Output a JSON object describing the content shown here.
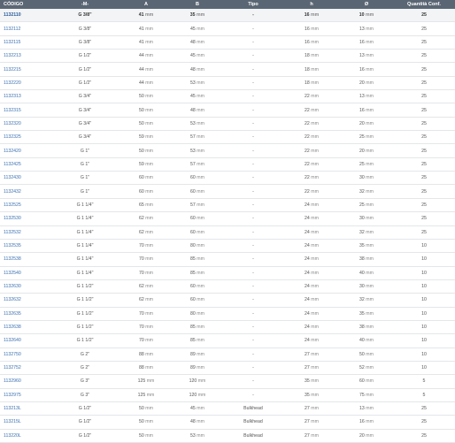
{
  "table": {
    "headers": [
      "CÓDIGO",
      "-M-",
      "A",
      "B",
      "Tipo",
      "h",
      "Ø",
      "Quantità Conf."
    ],
    "unit": "mm",
    "rows": [
      {
        "code": "1132110",
        "m": "G 3/8\"",
        "a": "41",
        "b": "35",
        "tipo": "-",
        "h": "16",
        "d": "10",
        "q": "25"
      },
      {
        "code": "1132112",
        "m": "G 3/8\"",
        "a": "41",
        "b": "45",
        "tipo": "-",
        "h": "16",
        "d": "13",
        "q": "25"
      },
      {
        "code": "1132115",
        "m": "G 3/8\"",
        "a": "41",
        "b": "48",
        "tipo": "-",
        "h": "16",
        "d": "16",
        "q": "25"
      },
      {
        "code": "1132213",
        "m": "G 1/2\"",
        "a": "44",
        "b": "45",
        "tipo": "-",
        "h": "18",
        "d": "13",
        "q": "25"
      },
      {
        "code": "1132215",
        "m": "G 1/2\"",
        "a": "44",
        "b": "48",
        "tipo": "-",
        "h": "18",
        "d": "16",
        "q": "25"
      },
      {
        "code": "1132220",
        "m": "G 1/2\"",
        "a": "44",
        "b": "53",
        "tipo": "-",
        "h": "18",
        "d": "20",
        "q": "25"
      },
      {
        "code": "1132313",
        "m": "G 3/4\"",
        "a": "50",
        "b": "45",
        "tipo": "-",
        "h": "22",
        "d": "13",
        "q": "25"
      },
      {
        "code": "1132315",
        "m": "G 3/4\"",
        "a": "50",
        "b": "48",
        "tipo": "-",
        "h": "22",
        "d": "16",
        "q": "25"
      },
      {
        "code": "1132320",
        "m": "G 3/4\"",
        "a": "50",
        "b": "53",
        "tipo": "-",
        "h": "22",
        "d": "20",
        "q": "25"
      },
      {
        "code": "1132325",
        "m": "G 3/4\"",
        "a": "59",
        "b": "57",
        "tipo": "-",
        "h": "22",
        "d": "25",
        "q": "25"
      },
      {
        "code": "1132420",
        "m": "G 1\"",
        "a": "50",
        "b": "53",
        "tipo": "-",
        "h": "22",
        "d": "20",
        "q": "25"
      },
      {
        "code": "1132425",
        "m": "G 1\"",
        "a": "59",
        "b": "57",
        "tipo": "-",
        "h": "22",
        "d": "25",
        "q": "25"
      },
      {
        "code": "1132430",
        "m": "G 1\"",
        "a": "60",
        "b": "60",
        "tipo": "-",
        "h": "22",
        "d": "30",
        "q": "25"
      },
      {
        "code": "1132432",
        "m": "G 1\"",
        "a": "60",
        "b": "60",
        "tipo": "-",
        "h": "22",
        "d": "32",
        "q": "25"
      },
      {
        "code": "1132525",
        "m": "G 1 1/4\"",
        "a": "65",
        "b": "57",
        "tipo": "-",
        "h": "24",
        "d": "25",
        "q": "25"
      },
      {
        "code": "1132530",
        "m": "G 1 1/4\"",
        "a": "62",
        "b": "60",
        "tipo": "-",
        "h": "24",
        "d": "30",
        "q": "25"
      },
      {
        "code": "1132532",
        "m": "G 1 1/4\"",
        "a": "62",
        "b": "60",
        "tipo": "-",
        "h": "24",
        "d": "32",
        "q": "25"
      },
      {
        "code": "1132535",
        "m": "G 1 1/4\"",
        "a": "70",
        "b": "80",
        "tipo": "-",
        "h": "24",
        "d": "35",
        "q": "10"
      },
      {
        "code": "1132538",
        "m": "G 1 1/4\"",
        "a": "70",
        "b": "85",
        "tipo": "-",
        "h": "24",
        "d": "38",
        "q": "10"
      },
      {
        "code": "1132540",
        "m": "G 1 1/4\"",
        "a": "70",
        "b": "85",
        "tipo": "-",
        "h": "24",
        "d": "40",
        "q": "10"
      },
      {
        "code": "1132630",
        "m": "G 1 1/2\"",
        "a": "62",
        "b": "60",
        "tipo": "-",
        "h": "24",
        "d": "30",
        "q": "10"
      },
      {
        "code": "1132632",
        "m": "G 1 1/2\"",
        "a": "62",
        "b": "60",
        "tipo": "-",
        "h": "24",
        "d": "32",
        "q": "10"
      },
      {
        "code": "1132635",
        "m": "G 1 1/2\"",
        "a": "70",
        "b": "80",
        "tipo": "-",
        "h": "24",
        "d": "35",
        "q": "10"
      },
      {
        "code": "1132638",
        "m": "G 1 1/2\"",
        "a": "70",
        "b": "85",
        "tipo": "-",
        "h": "24",
        "d": "38",
        "q": "10"
      },
      {
        "code": "1132640",
        "m": "G 1 1/2\"",
        "a": "70",
        "b": "85",
        "tipo": "-",
        "h": "24",
        "d": "40",
        "q": "10"
      },
      {
        "code": "1132750",
        "m": "G 2\"",
        "a": "88",
        "b": "89",
        "tipo": "-",
        "h": "27",
        "d": "50",
        "q": "10"
      },
      {
        "code": "1132752",
        "m": "G 2\"",
        "a": "88",
        "b": "89",
        "tipo": "-",
        "h": "27",
        "d": "52",
        "q": "10"
      },
      {
        "code": "1132960",
        "m": "G 3\"",
        "a": "125",
        "b": "120",
        "tipo": "-",
        "h": "35",
        "d": "60",
        "q": "5"
      },
      {
        "code": "1132975",
        "m": "G 3\"",
        "a": "125",
        "b": "120",
        "tipo": "-",
        "h": "35",
        "d": "75",
        "q": "5"
      },
      {
        "code": "113213L",
        "m": "G 1/2\"",
        "a": "50",
        "b": "45",
        "tipo": "Bulkhead",
        "h": "27",
        "d": "13",
        "q": "25"
      },
      {
        "code": "113215L",
        "m": "G 1/2\"",
        "a": "50",
        "b": "48",
        "tipo": "Bulkhead",
        "h": "27",
        "d": "16",
        "q": "25"
      },
      {
        "code": "113220L",
        "m": "G 1/2\"",
        "a": "50",
        "b": "53",
        "tipo": "Bulkhead",
        "h": "27",
        "d": "20",
        "q": "25"
      }
    ]
  }
}
